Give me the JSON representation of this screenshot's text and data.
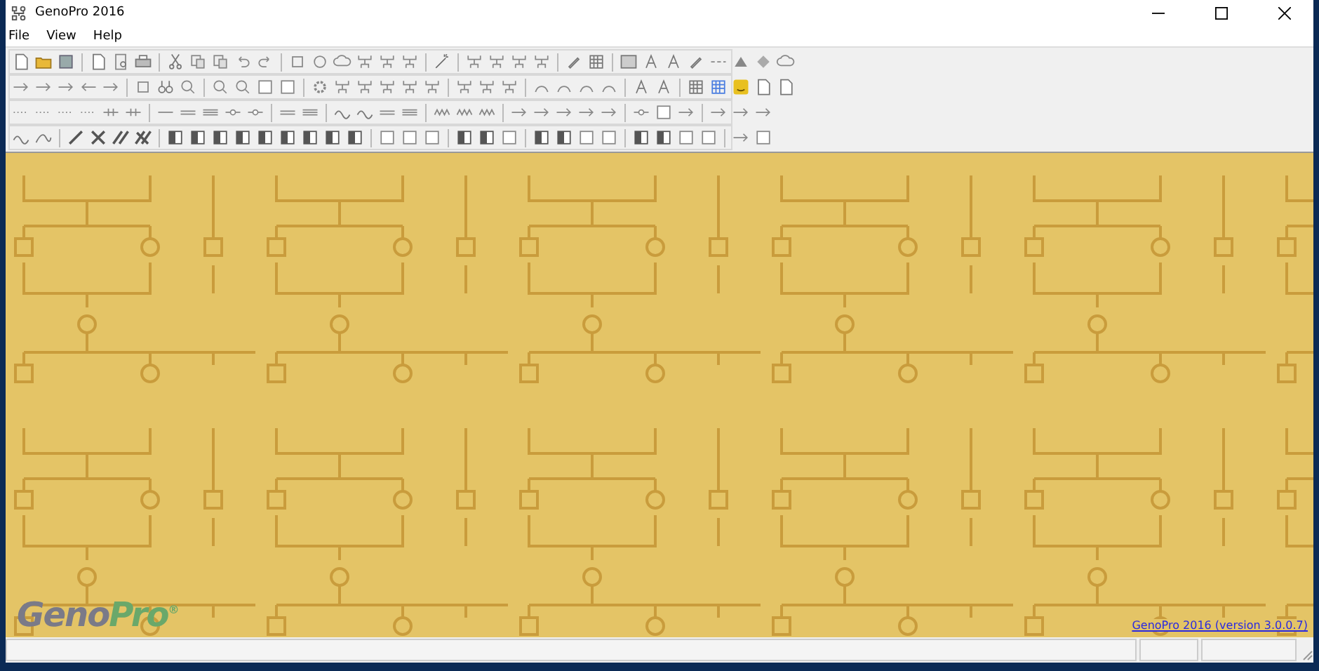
{
  "window": {
    "title": "GenoPro 2016"
  },
  "menu": [
    {
      "label": "File"
    },
    {
      "label": "View"
    },
    {
      "label": "Help"
    }
  ],
  "canvas": {
    "logo": {
      "text": "Geno",
      "accent": "Pro",
      "mark": "®"
    },
    "version_link": "GenoPro 2016 (version 3.0.0.7)"
  }
}
